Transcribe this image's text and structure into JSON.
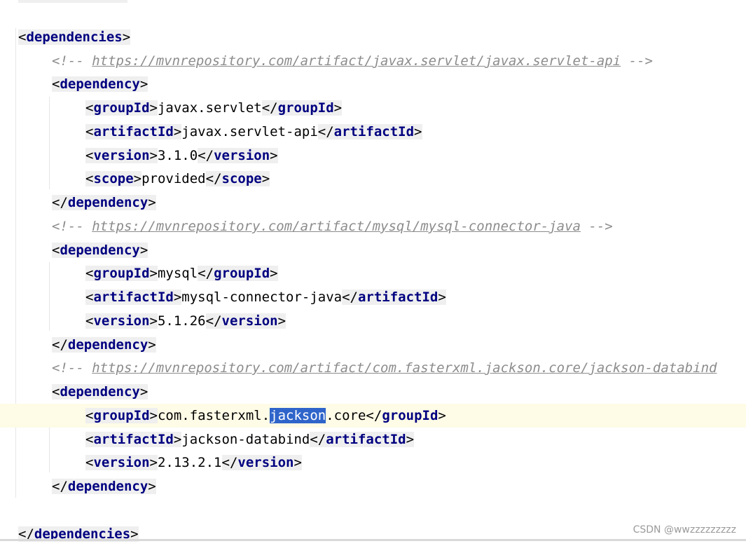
{
  "editor": {
    "lines": {
      "deps_open": "dependencies",
      "comment_servlet": "https://mvnrepository.com/artifact/javax.servlet/javax.servlet-api",
      "dep": "dependency",
      "groupId": "groupId",
      "artifactId": "artifactId",
      "version": "version",
      "scope": "scope",
      "servlet_group": "javax.servlet",
      "servlet_artifact": "javax.servlet-api",
      "servlet_version": "3.1.0",
      "servlet_scope": "provided",
      "comment_mysql": "https://mvnrepository.com/artifact/mysql/mysql-connector-java",
      "mysql_group": "mysql",
      "mysql_artifact": "mysql-connector-java",
      "mysql_version": "5.1.26",
      "comment_jackson": "https://mvnrepository.com/artifact/com.fasterxml.jackson.core/jackson-databind",
      "jackson_group_prefix": "com.fasterxml.",
      "jackson_group_selected": "jackson",
      "jackson_group_suffix": ".core",
      "jackson_artifact": "jackson-databind",
      "jackson_version": "2.13.2.1",
      "deps_close": "dependencies"
    }
  },
  "watermark": "CSDN @wwzzzzzzzzz"
}
